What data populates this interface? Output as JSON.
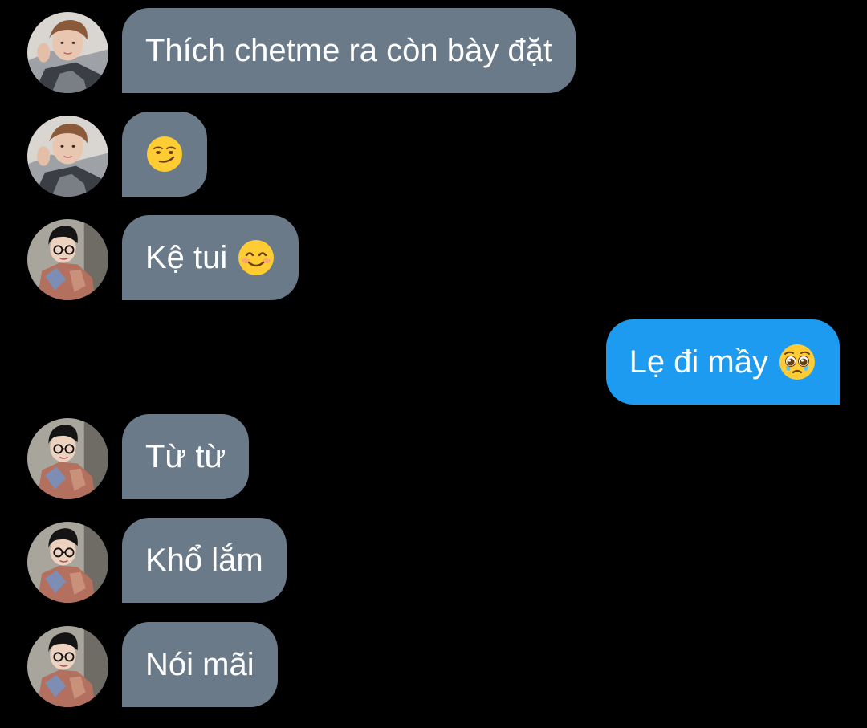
{
  "messages": [
    {
      "sender": "friend_a",
      "text": "Thích chetme ra còn bày đặt",
      "emoji": null
    },
    {
      "sender": "friend_a",
      "text": "",
      "emoji": "smirking-face"
    },
    {
      "sender": "friend_b",
      "text": "Kệ tui",
      "emoji": "smiling-face-with-smiling-eyes"
    },
    {
      "sender": "me",
      "text": "Lẹ đi mầy",
      "emoji": "pleading-face"
    },
    {
      "sender": "friend_b",
      "text": "Từ từ",
      "emoji": null
    },
    {
      "sender": "friend_b",
      "text": "Khổ lắm",
      "emoji": null
    },
    {
      "sender": "friend_b",
      "text": "Nói mãi",
      "emoji": null
    }
  ],
  "colors": {
    "background": "#000000",
    "incoming_bubble": "#6a7a89",
    "outgoing_bubble": "#1d9bf0",
    "text": "#ffffff"
  }
}
